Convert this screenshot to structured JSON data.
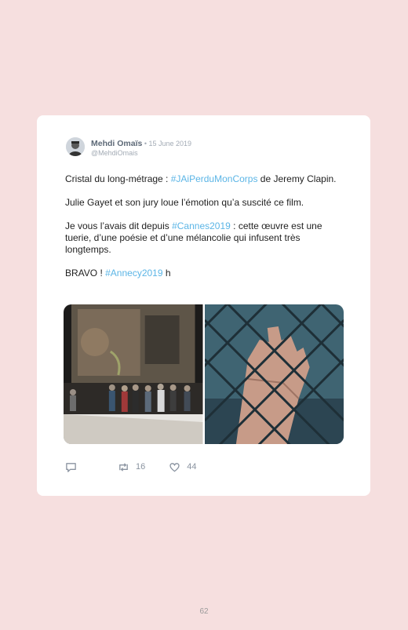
{
  "tweet": {
    "author": "Mehdi Omaïs",
    "separator": " • ",
    "date": "15 June 2019",
    "handle": "@MehdiOmais",
    "line1_pre": "Cristal du long-métrage : ",
    "line1_tag": "#JAiPerduMonCorps",
    "line1_post": " de Jeremy Clapin.",
    "line2": "Julie Gayet et son jury loue l’émotion qu’a suscité ce film.",
    "line3_pre": "Je vous l’avais dit depuis ",
    "line3_tag": "#Cannes2019",
    "line3_post": " : cette œuvre est une tuerie, d’une poésie et d’une mélancolie qui infusent très longtemps.",
    "line4_pre": "BRAVO ! ",
    "line4_tag": "#Annecy2019",
    "line4_post": " h",
    "retweets": "16",
    "likes": "44"
  },
  "page": {
    "number": "62"
  },
  "colors": {
    "background": "#f6dfdf",
    "hashtag": "#5bb5e6",
    "card": "#ffffff"
  },
  "icons": {
    "reply": "reply-icon",
    "retweet": "retweet-icon",
    "like": "heart-icon"
  }
}
